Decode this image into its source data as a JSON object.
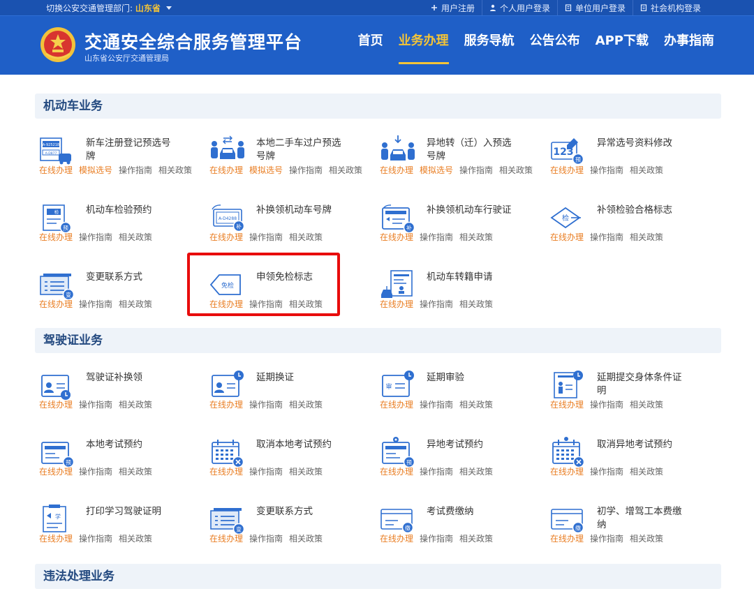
{
  "topbar": {
    "region_prefix": "切换公安交通管理部门:",
    "region_name": "山东省",
    "links": [
      {
        "label": "用户注册",
        "icon": "plus-icon"
      },
      {
        "label": "个人用户登录",
        "icon": "person-icon"
      },
      {
        "label": "单位用户登录",
        "icon": "building-icon"
      },
      {
        "label": "社会机构登录",
        "icon": "document-icon"
      }
    ]
  },
  "header": {
    "title": "交通安全综合服务管理平台",
    "subtitle": "山东省公安厅交通管理局",
    "nav": [
      {
        "label": "首页",
        "active": false
      },
      {
        "label": "业务办理",
        "active": true
      },
      {
        "label": "服务导航",
        "active": false
      },
      {
        "label": "公告公布",
        "active": false
      },
      {
        "label": "APP下载",
        "active": false
      },
      {
        "label": "办事指南",
        "active": false
      }
    ]
  },
  "colors": {
    "accent": "#f4c437",
    "header": "#1f5fc7",
    "link_orange": "#e97d22",
    "highlight": "#e80c0c"
  },
  "sections": [
    {
      "title": "机动车业务",
      "items": [
        {
          "name": "新车注册登记预选号牌",
          "links": [
            "在线办理",
            "模拟选号",
            "操作指南",
            "相关政策"
          ],
          "icon": "plate-select-icon"
        },
        {
          "name": "本地二手车过户预选号牌",
          "links": [
            "在线办理",
            "模拟选号",
            "操作指南",
            "相关政策"
          ],
          "icon": "car-transfer-icon"
        },
        {
          "name": "异地转（迁）入预选号牌",
          "links": [
            "在线办理",
            "模拟选号",
            "操作指南",
            "相关政策"
          ],
          "icon": "car-transfer-in-icon"
        },
        {
          "name": "异常选号资料修改",
          "links": [
            "在线办理",
            "操作指南",
            "相关政策"
          ],
          "icon": "number-edit-icon"
        },
        {
          "name": "机动车检验预约",
          "links": [
            "在线办理",
            "操作指南",
            "相关政策"
          ],
          "icon": "inspection-appointment-icon"
        },
        {
          "name": "补换领机动车号牌",
          "links": [
            "在线办理",
            "操作指南",
            "相关政策"
          ],
          "icon": "plate-replace-icon"
        },
        {
          "name": "补换领机动车行驶证",
          "links": [
            "在线办理",
            "操作指南",
            "相关政策"
          ],
          "icon": "license-replace-icon"
        },
        {
          "name": "补领检验合格标志",
          "links": [
            "在线办理",
            "操作指南",
            "相关政策"
          ],
          "icon": "inspection-mark-icon"
        },
        {
          "name": "变更联系方式",
          "links": [
            "在线办理",
            "操作指南",
            "相关政策"
          ],
          "icon": "contact-change-icon"
        },
        {
          "name": "申领免检标志",
          "links": [
            "在线办理",
            "操作指南",
            "相关政策"
          ],
          "icon": "exempt-mark-icon",
          "badge": "免检"
        },
        {
          "name": "机动车转籍申请",
          "links": [
            "在线办理",
            "操作指南",
            "相关政策"
          ],
          "icon": "vehicle-transfer-icon"
        }
      ]
    },
    {
      "title": "驾驶证业务",
      "items": [
        {
          "name": "驾驶证补换领",
          "links": [
            "在线办理",
            "操作指南",
            "相关政策"
          ],
          "icon": "driver-license-replace-icon"
        },
        {
          "name": "延期换证",
          "links": [
            "在线办理",
            "操作指南",
            "相关政策"
          ],
          "icon": "renewal-delay-icon"
        },
        {
          "name": "延期审验",
          "links": [
            "在线办理",
            "操作指南",
            "相关政策"
          ],
          "icon": "review-delay-icon",
          "badge": "审"
        },
        {
          "name": "延期提交身体条件证明",
          "links": [
            "在线办理",
            "操作指南",
            "相关政策"
          ],
          "icon": "health-proof-icon"
        },
        {
          "name": "本地考试预约",
          "links": [
            "在线办理",
            "操作指南",
            "相关政策"
          ],
          "icon": "local-exam-icon"
        },
        {
          "name": "取消本地考试预约",
          "links": [
            "在线办理",
            "操作指南",
            "相关政策"
          ],
          "icon": "cancel-local-exam-icon"
        },
        {
          "name": "异地考试预约",
          "links": [
            "在线办理",
            "操作指南",
            "相关政策"
          ],
          "icon": "remote-exam-icon"
        },
        {
          "name": "取消异地考试预约",
          "links": [
            "在线办理",
            "操作指南",
            "相关政策"
          ],
          "icon": "cancel-remote-exam-icon"
        },
        {
          "name": "打印学习驾驶证明",
          "links": [
            "在线办理",
            "操作指南",
            "相关政策"
          ],
          "icon": "learner-permit-print-icon"
        },
        {
          "name": "变更联系方式",
          "links": [
            "在线办理",
            "操作指南",
            "相关政策"
          ],
          "icon": "contact-change-icon"
        },
        {
          "name": "考试费缴纳",
          "links": [
            "在线办理",
            "操作指南",
            "相关政策"
          ],
          "icon": "exam-fee-icon"
        },
        {
          "name": "初学、增驾工本费缴纳",
          "links": [
            "在线办理",
            "操作指南",
            "相关政策"
          ],
          "icon": "production-fee-icon"
        }
      ]
    },
    {
      "title": "违法处理业务",
      "items": []
    }
  ],
  "badges": {
    "yu": "预",
    "bu": "补",
    "bian": "变",
    "jian": "检",
    "che": "A-D4288",
    "che2": "A-925218",
    "che3": "A-D877",
    "num": "123",
    "xue": "学",
    "jiao": "缴"
  }
}
